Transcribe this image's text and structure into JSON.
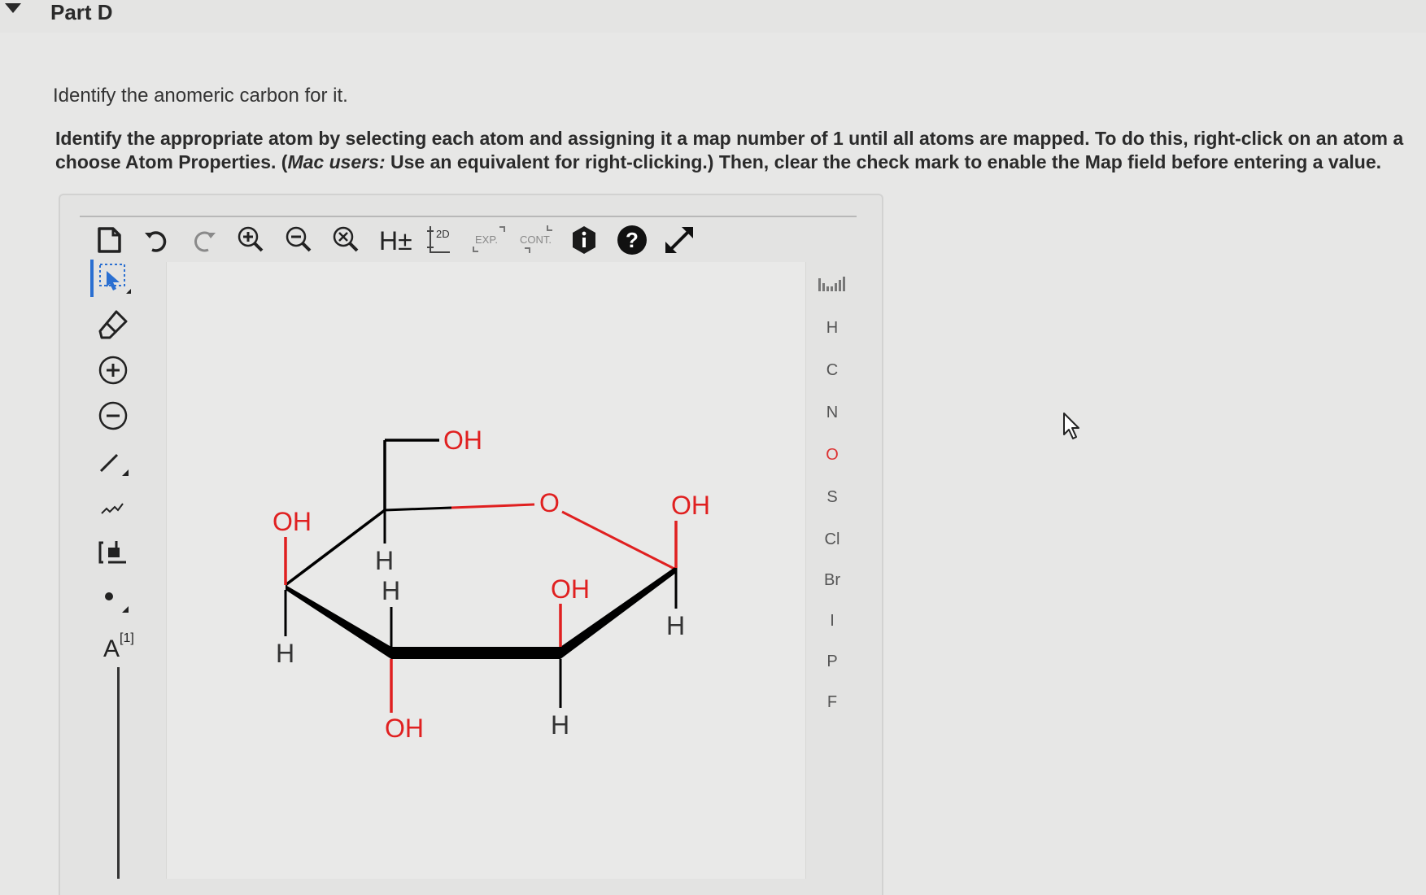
{
  "part": {
    "title": "Part D"
  },
  "question": {
    "text": "Identify the anomeric carbon for it."
  },
  "instructions": {
    "line1": "Identify the appropriate atom by selecting each atom and assigning it a map number of 1 until all atoms are mapped. To do this, right-click on an atom a",
    "line2_before": "choose Atom Properties. (",
    "line2_em": "Mac users:",
    "line2_after": " Use an equivalent for right-clicking.) Then, clear the check mark to enable the Map field before entering a value."
  },
  "toolbar": {
    "items": [
      {
        "name": "new-document-icon"
      },
      {
        "name": "undo-icon"
      },
      {
        "name": "redo-icon"
      },
      {
        "name": "zoom-in-icon"
      },
      {
        "name": "zoom-out-icon"
      },
      {
        "name": "zoom-reset-icon"
      },
      {
        "name": "hydrogen-toggle-button",
        "label": "H±"
      },
      {
        "name": "clean-2d-button",
        "label": "2D"
      },
      {
        "name": "expand-button",
        "label": "EXP."
      },
      {
        "name": "contract-button",
        "label": "CONT."
      },
      {
        "name": "info-icon"
      },
      {
        "name": "help-icon"
      },
      {
        "name": "fullscreen-icon"
      }
    ]
  },
  "left_tools": {
    "map_label": "A",
    "map_sup": "[1]"
  },
  "periodic": {
    "elements": [
      "H",
      "C",
      "N",
      "O",
      "S",
      "Cl",
      "Br",
      "I",
      "P",
      "F"
    ]
  },
  "molecule": {
    "labels": {
      "ch2oh": "OH",
      "ring_o": "O",
      "c1_oh": "OH",
      "c1_h": "H",
      "c2_oh": "OH",
      "c2_h": "H",
      "c3_oh": "OH",
      "c3_h": "H",
      "c4_oh": "OH",
      "c4_h": "H",
      "c5_h": "H"
    },
    "colors": {
      "oxygen": "#e02020",
      "bond": "#000000"
    }
  }
}
